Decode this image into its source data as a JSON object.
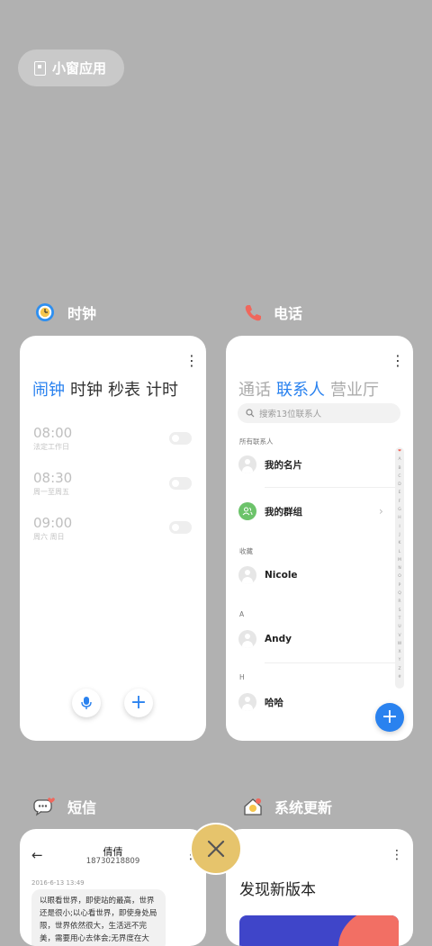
{
  "small_window": {
    "label": "小窗应用"
  },
  "apps": {
    "clock": {
      "name": "时钟",
      "tabs": [
        "闹钟",
        "时钟",
        "秒表",
        "计时"
      ],
      "alarms": [
        {
          "time": "08:00",
          "repeat": "法定工作日",
          "enabled": false
        },
        {
          "time": "08:30",
          "repeat": "周一至周五",
          "enabled": false
        },
        {
          "time": "09:00",
          "repeat": "周六 周日",
          "enabled": false
        }
      ]
    },
    "phone": {
      "name": "电话",
      "tabs": [
        "通话",
        "联系人",
        "营业厅"
      ],
      "search_placeholder": "搜索13位联系人",
      "all_contacts_label": "所有联系人",
      "my_card": "我的名片",
      "my_groups": "我的群组",
      "favorites_label": "收藏",
      "favorite_contacts": [
        "Nicole"
      ],
      "section_a": "A",
      "a_contacts": [
        "Andy"
      ],
      "section_h": "H",
      "h_contacts": [
        "哈哈"
      ],
      "alphabet": [
        "❤",
        "A",
        "B",
        "C",
        "D",
        "E",
        "F",
        "G",
        "H",
        "I",
        "J",
        "K",
        "L",
        "M",
        "N",
        "O",
        "P",
        "Q",
        "R",
        "S",
        "T",
        "U",
        "V",
        "W",
        "X",
        "Y",
        "Z",
        "#"
      ]
    },
    "messages": {
      "name": "短信",
      "contact_name": "倩倩",
      "contact_number": "18730218809",
      "timestamp": "2016-6-13 13:49",
      "message": "以眼看世界，即使站的最高，世界还是很小;以心看世界，即使身处局限，世界依然很大，生活远不完美，需要用心去体会;无界度在大"
    },
    "update": {
      "name": "系统更新",
      "title": "发现新版本"
    }
  },
  "colors": {
    "accent": "#2a82ef",
    "background": "#b1b1b1",
    "close_button": "#e6c46c"
  }
}
